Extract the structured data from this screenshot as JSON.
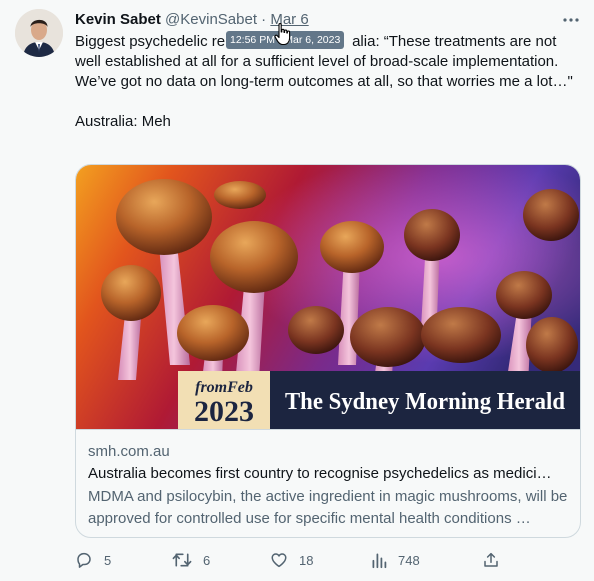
{
  "tweet": {
    "author_name": "Kevin Sabet",
    "author_handle": "@KevinSabet",
    "separator": "·",
    "date": "Mar 6",
    "tooltip": "12:56 PM · Mar 6, 2023",
    "text_line1_visible": "Biggest psychedelic re",
    "text_line1_after": "alia: “These treatments are not",
    "text_body": "well established at all for a sufficient level of broad-scale implementation. We’ve got no data on long-term outcomes at all, so that worries me a lot…\"",
    "text_last": "Australia: Meh"
  },
  "card": {
    "badge_from": "from",
    "badge_month": "Feb",
    "badge_year": "2023",
    "masthead": "The Sydney Morning Herald",
    "domain": "smh.com.au",
    "title": "Australia becomes first country to recognise psychedelics as medici…",
    "description": "MDMA and psilocybin, the active ingredient in magic mushrooms, will be approved for controlled use for specific mental health conditions …"
  },
  "actions": {
    "replies": "5",
    "retweets": "6",
    "likes": "18",
    "views": "748"
  },
  "icons": {
    "more": "more-icon",
    "reply": "reply-icon",
    "retweet": "retweet-icon",
    "like": "like-icon",
    "views": "views-icon",
    "share": "share-icon"
  },
  "colors": {
    "background": "#f7f9f9",
    "text": "#0f1419",
    "secondary": "#536471",
    "border": "#cfd9de",
    "masthead_bg": "#1c2540",
    "badge_bg": "#f2dfb4"
  }
}
